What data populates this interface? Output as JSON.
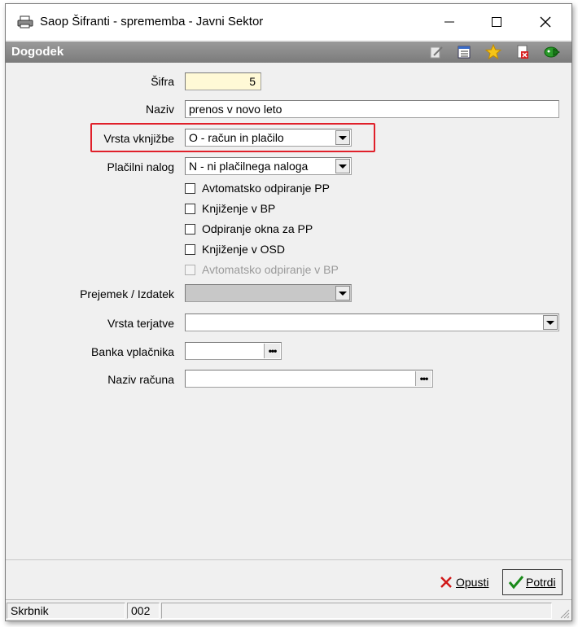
{
  "window": {
    "title": "Saop Šifranti - sprememba - Javni Sektor"
  },
  "header": {
    "title": "Dogodek"
  },
  "toolbar": {
    "icons": [
      "edit-icon",
      "list-icon",
      "star-icon",
      "delete-icon",
      "exit-icon"
    ]
  },
  "form": {
    "sifra": {
      "label": "Šifra",
      "value": "5"
    },
    "naziv": {
      "label": "Naziv",
      "value": "prenos v novo leto"
    },
    "vrsta_vknjizbe": {
      "label": "Vrsta vknjižbe",
      "value": "O - račun in plačilo"
    },
    "placilni_nalog": {
      "label": "Plačilni nalog",
      "value": "N - ni plačilnega naloga"
    },
    "checkboxes": [
      {
        "label": "Avtomatsko odpiranje PP",
        "checked": false,
        "enabled": true
      },
      {
        "label": "Knjiženje v BP",
        "checked": false,
        "enabled": true
      },
      {
        "label": "Odpiranje okna za PP",
        "checked": false,
        "enabled": true
      },
      {
        "label": "Knjiženje v OSD",
        "checked": false,
        "enabled": true
      },
      {
        "label": "Avtomatsko odpiranje v BP",
        "checked": false,
        "enabled": false
      }
    ],
    "prejemek_izdatek": {
      "label": "Prejemek / Izdatek",
      "value": ""
    },
    "vrsta_terjatve": {
      "label": "Vrsta terjatve",
      "value": ""
    },
    "banka_vplacnika": {
      "label": "Banka vplačnika",
      "value": ""
    },
    "naziv_racuna": {
      "label": "Naziv računa",
      "value": ""
    }
  },
  "buttons": {
    "cancel_label": "Opusti",
    "confirm_label": "Potrdi"
  },
  "status": {
    "user": "Skrbnik",
    "code": "002"
  },
  "colors": {
    "highlight": "#e0202a",
    "header": "#8a8a8a",
    "yellow_field": "#fff9d6"
  }
}
